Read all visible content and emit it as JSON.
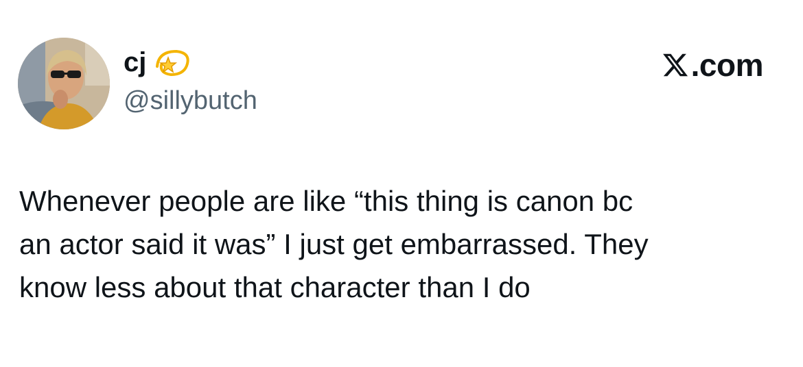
{
  "author": {
    "display_name": "cj",
    "handle": "@sillybutch",
    "name_emoji_icon": "dizzy-star-icon",
    "avatar_icon": "profile-photo-person-sunglasses"
  },
  "site": {
    "logo_icon": "x-logo-icon",
    "text": ".com"
  },
  "tweet": {
    "lines": [
      "Whenever people are like “this thing is canon bc",
      "an actor said it was” I just get embarrassed. They",
      "know less about that character than I do"
    ]
  },
  "colors": {
    "text_primary": "#0f1419",
    "text_secondary": "#536471",
    "background": "#ffffff"
  }
}
